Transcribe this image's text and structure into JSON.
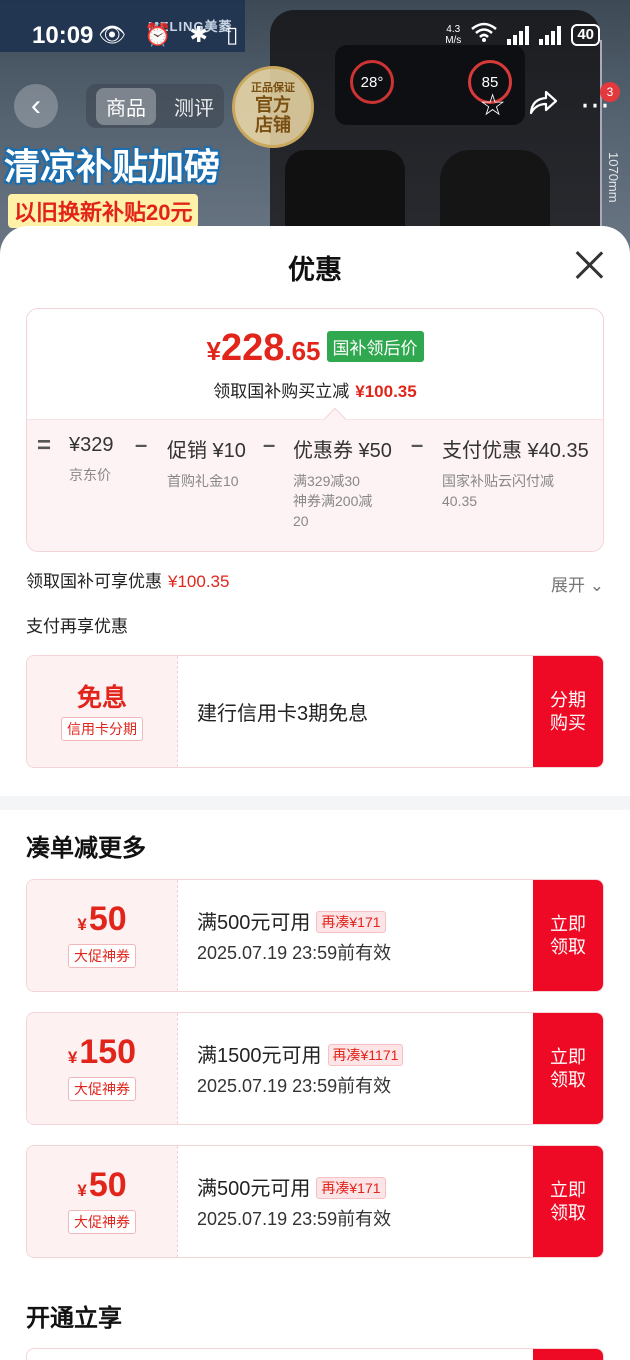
{
  "status": {
    "time": "10:09",
    "left_icons": "👁 ⏰ ✱ ▯",
    "net_speed_value": "4.3",
    "net_speed_unit": "M/s",
    "battery": "40"
  },
  "banner": {
    "brand": "MELING美菱",
    "promo_line1": "清凉补贴加磅",
    "promo_line2": "以旧换新补贴20元",
    "dial_left": "28°",
    "dial_right": "85",
    "height_label": "1070mm",
    "badge_small": "正品保证",
    "badge_line1": "官方",
    "badge_line2": "店铺"
  },
  "nav": {
    "back": "‹",
    "tabs": [
      "商品",
      "测评"
    ],
    "notif_count": "3"
  },
  "sheet": {
    "title": "优惠",
    "final_price": {
      "currency": "¥",
      "integer": "228",
      "decimal": ".65",
      "tag": "国补领后价"
    },
    "instant_saving": {
      "text": "领取国补购买立减",
      "amount": "¥100.35"
    },
    "breakdown": {
      "equals": "=",
      "minus": "–",
      "items": [
        {
          "label": "¥329",
          "sub": "京东价"
        },
        {
          "label": "促销 ¥10",
          "sub": "首购礼金10"
        },
        {
          "label": "优惠券 ¥50",
          "sub1": "满329减30",
          "sub2": "神券满200减",
          "sub3": "20"
        },
        {
          "label": "支付优惠 ¥40.35",
          "sub1": "国家补贴云闪付减",
          "sub2": "40.35"
        }
      ]
    },
    "subsidy_note": {
      "text": "领取国补可享优惠",
      "amount": "¥100.35"
    },
    "expand_label": "展开 ⌄",
    "pay_note": "支付再享优惠",
    "installment": {
      "big": "免息",
      "chip": "信用卡分期",
      "desc": "建行信用卡3期免息",
      "action_line1": "分期",
      "action_line2": "购买"
    },
    "more_section": "凑单减更多",
    "coupons": [
      {
        "currency": "¥",
        "value": "50",
        "chip": "大促神券",
        "condition": "满500元可用",
        "pill": "再凑¥171",
        "expiry": "2025.07.19 23:59前有效",
        "action_line1": "立即",
        "action_line2": "领取"
      },
      {
        "currency": "¥",
        "value": "150",
        "chip": "大促神券",
        "condition": "满1500元可用",
        "pill": "再凑¥1171",
        "expiry": "2025.07.19 23:59前有效",
        "action_line1": "立即",
        "action_line2": "领取"
      },
      {
        "currency": "¥",
        "value": "50",
        "chip": "大促神券",
        "condition": "满500元可用",
        "pill": "再凑¥171",
        "expiry": "2025.07.19 23:59前有效",
        "action_line1": "立即",
        "action_line2": "领取"
      }
    ],
    "open_section": "开通立享"
  },
  "colors": {
    "accent": "#ee0a24",
    "price_red": "#e1251b",
    "tag_green": "#2fa84f"
  }
}
